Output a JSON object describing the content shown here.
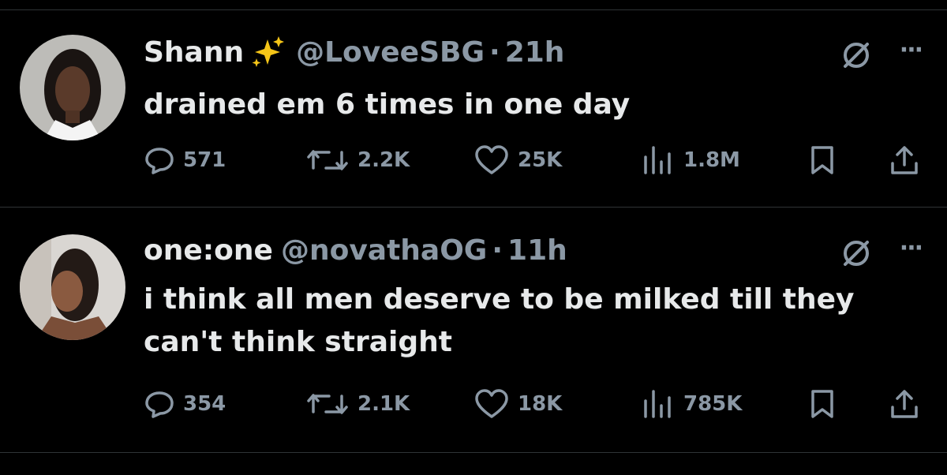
{
  "tweets": [
    {
      "name": "Shann",
      "name_emoji": "sparkles-icon",
      "handle": "@LoveeSBG",
      "time": "21h",
      "text": "drained em 6 times in one day",
      "replies": "571",
      "reposts": "2.2K",
      "likes": "25K",
      "views": "1.8M"
    },
    {
      "name": "one:one",
      "handle": "@novathaOG",
      "time": "11h",
      "text": "i think all men deserve to be milked till they can't think straight",
      "replies": "354",
      "reposts": "2.1K",
      "likes": "18K",
      "views": "785K"
    }
  ],
  "separator": "·",
  "more_label": "···",
  "colors": {
    "background": "#000000",
    "text": "#e7e9ea",
    "secondary": "#8b98a5",
    "divider": "#2f3336",
    "sparkle": "#f5c518"
  }
}
